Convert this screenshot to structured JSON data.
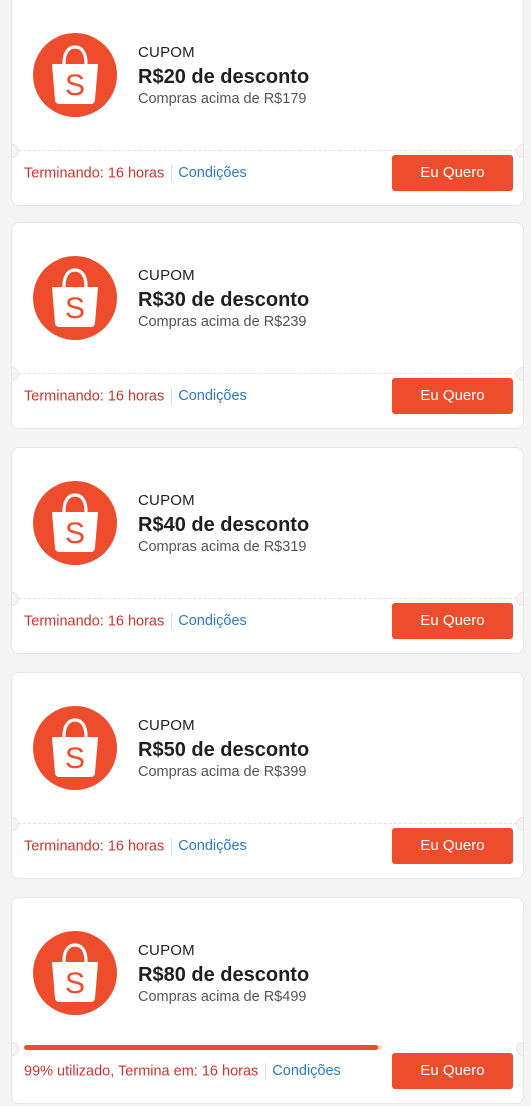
{
  "coupons": [
    {
      "kind": "CUPOM",
      "title": "R$20 de desconto",
      "subtitle": "Compras acima de R$179",
      "status": "Terminando: 16 horas",
      "conditions": "Condições",
      "button": "Eu Quero"
    },
    {
      "kind": "CUPOM",
      "title": "R$30 de desconto",
      "subtitle": "Compras acima de R$239",
      "status": "Terminando: 16 horas",
      "conditions": "Condições",
      "button": "Eu Quero"
    },
    {
      "kind": "CUPOM",
      "title": "R$40 de desconto",
      "subtitle": "Compras acima de R$319",
      "status": "Terminando: 16 horas",
      "conditions": "Condições",
      "button": "Eu Quero"
    },
    {
      "kind": "CUPOM",
      "title": "R$50 de desconto",
      "subtitle": "Compras acima de R$399",
      "status": "Terminando: 16 horas",
      "conditions": "Condições",
      "button": "Eu Quero"
    },
    {
      "kind": "CUPOM",
      "title": "R$80 de desconto",
      "subtitle": "Compras acima de R$499",
      "status": "99% utilizado, Termina em: 16 horas",
      "conditions": "Condições",
      "button": "Eu Quero",
      "usage_percent": 99
    }
  ],
  "icon": "shopee-bag-icon",
  "colors": {
    "brand": "#ee4d2d",
    "status_text": "#d0342c",
    "link": "#2a7bc4"
  }
}
